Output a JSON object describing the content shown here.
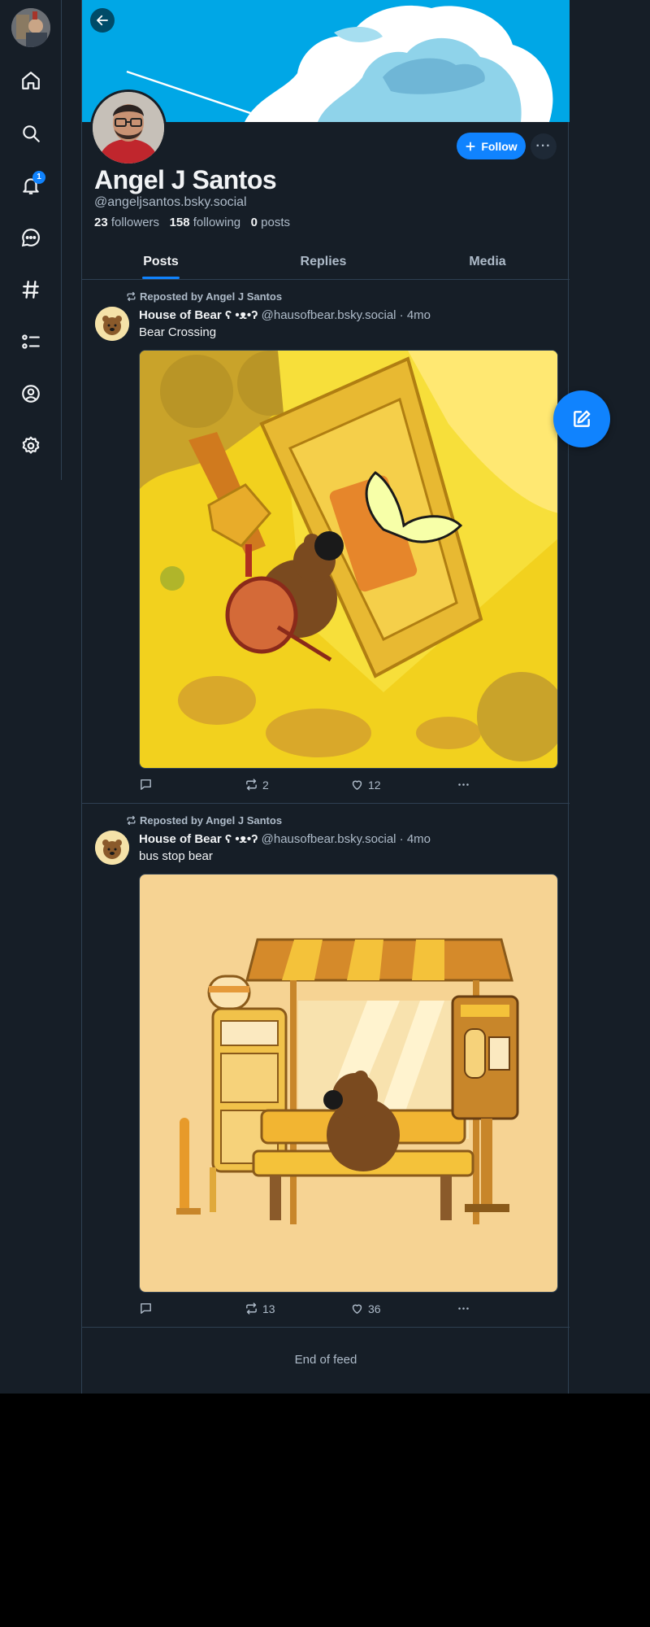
{
  "colors": {
    "accent": "#1083fe",
    "background": "#161e27",
    "border": "#2e4052",
    "muted": "#aebbc9",
    "text": "#f1f3f5"
  },
  "nav": {
    "items": [
      {
        "name": "home",
        "icon": "home-icon"
      },
      {
        "name": "search",
        "icon": "search-icon"
      },
      {
        "name": "notifications",
        "icon": "bell-icon",
        "badge": "1"
      },
      {
        "name": "chat",
        "icon": "chat-bubble-icon"
      },
      {
        "name": "feeds",
        "icon": "hashtag-icon"
      },
      {
        "name": "lists",
        "icon": "list-icon"
      },
      {
        "name": "profile",
        "icon": "user-circle-icon"
      },
      {
        "name": "settings",
        "icon": "gear-icon"
      }
    ]
  },
  "profile": {
    "display_name": "Angel J Santos",
    "handle": "@angeljsantos.bsky.social",
    "followers_count": "23",
    "followers_label": "followers",
    "following_count": "158",
    "following_label": "following",
    "posts_count": "0",
    "posts_label": "posts",
    "follow_label": "Follow",
    "more_label": "···"
  },
  "tabs": [
    {
      "label": "Posts",
      "active": true
    },
    {
      "label": "Replies",
      "active": false
    },
    {
      "label": "Media",
      "active": false
    }
  ],
  "posts": [
    {
      "repost_label": "Reposted by Angel J Santos",
      "author_name": "House of Bear ʕ •ᴥ•ʔ",
      "author_handle": "@hausofbear.bsky.social",
      "time": "· 4mo",
      "text": "Bear Crossing",
      "image_icon": "bear-mailbox-illustration",
      "replies": "",
      "reposts": "2",
      "likes": "12"
    },
    {
      "repost_label": "Reposted by Angel J Santos",
      "author_name": "House of Bear ʕ •ᴥ•ʔ",
      "author_handle": "@hausofbear.bsky.social",
      "time": "· 4mo",
      "text": "bus stop bear",
      "image_icon": "bear-bus-stop-illustration",
      "replies": "",
      "reposts": "13",
      "likes": "36"
    }
  ],
  "end_of_feed": "End of feed"
}
